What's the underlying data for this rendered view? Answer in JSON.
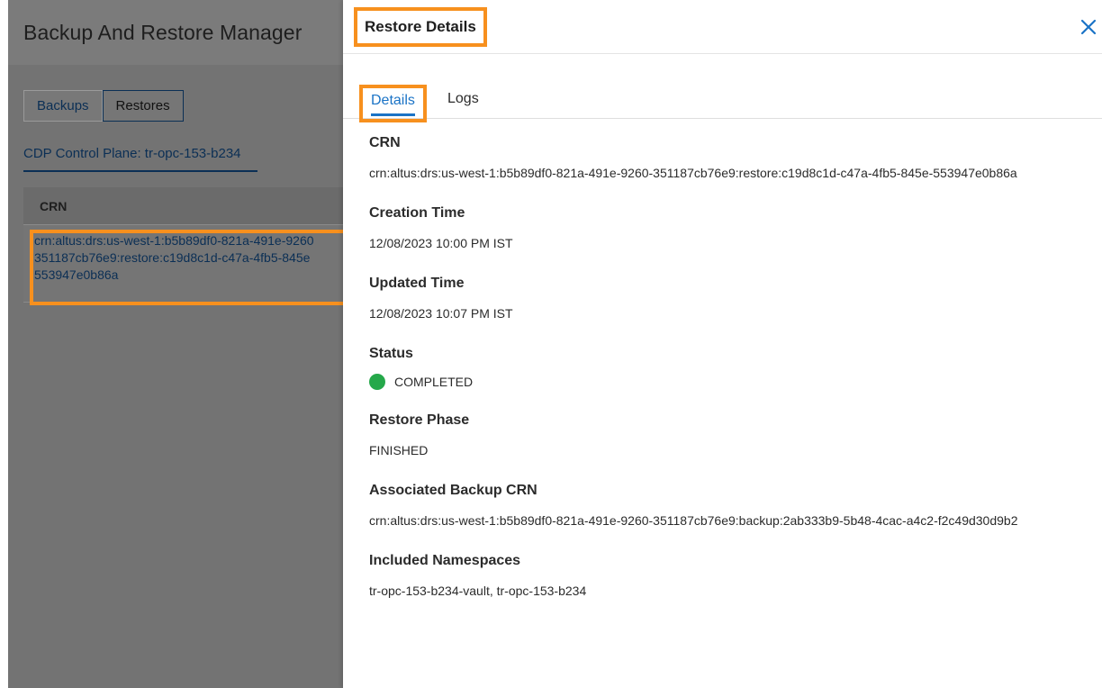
{
  "background": {
    "app_title": "Backup And Restore Manager",
    "segments": [
      {
        "label": "Backups",
        "active": false
      },
      {
        "label": "Restores",
        "active": true
      }
    ],
    "control_plane_tab": "CDP Control Plane: tr-opc-153-b234",
    "table": {
      "header": "CRN",
      "rows": [
        {
          "crn_lines": [
            "crn:altus:drs:us-west-1:b5b89df0-821a-491e-9260",
            "351187cb76e9:restore:c19d8c1d-c47a-4fb5-845e",
            "553947e0b86a"
          ]
        }
      ]
    }
  },
  "drawer": {
    "title": "Restore Details",
    "close_icon": "close-icon",
    "tabs": [
      {
        "label": "Details",
        "active": true
      },
      {
        "label": "Logs",
        "active": false
      }
    ],
    "fields": {
      "crn": {
        "label": "CRN",
        "value": "crn:altus:drs:us-west-1:b5b89df0-821a-491e-9260-351187cb76e9:restore:c19d8c1d-c47a-4fb5-845e-553947e0b86a"
      },
      "creation_time": {
        "label": "Creation Time",
        "value": "12/08/2023 10:00 PM IST"
      },
      "updated_time": {
        "label": "Updated Time",
        "value": "12/08/2023 10:07 PM IST"
      },
      "status": {
        "label": "Status",
        "value": "COMPLETED",
        "color": "#25a84a"
      },
      "restore_phase": {
        "label": "Restore Phase",
        "value": "FINISHED"
      },
      "associated_backup_crn": {
        "label": "Associated Backup CRN",
        "value": "crn:altus:drs:us-west-1:b5b89df0-821a-491e-9260-351187cb76e9:backup:2ab333b9-5b48-4cac-a4c2-f2c49d30d9b2"
      },
      "included_namespaces": {
        "label": "Included Namespaces",
        "value": "tr-opc-153-b234-vault, tr-opc-153-b234"
      }
    }
  },
  "colors": {
    "highlight": "#f7901e",
    "accent": "#1a73c6",
    "link_dark": "#0b2f55"
  }
}
